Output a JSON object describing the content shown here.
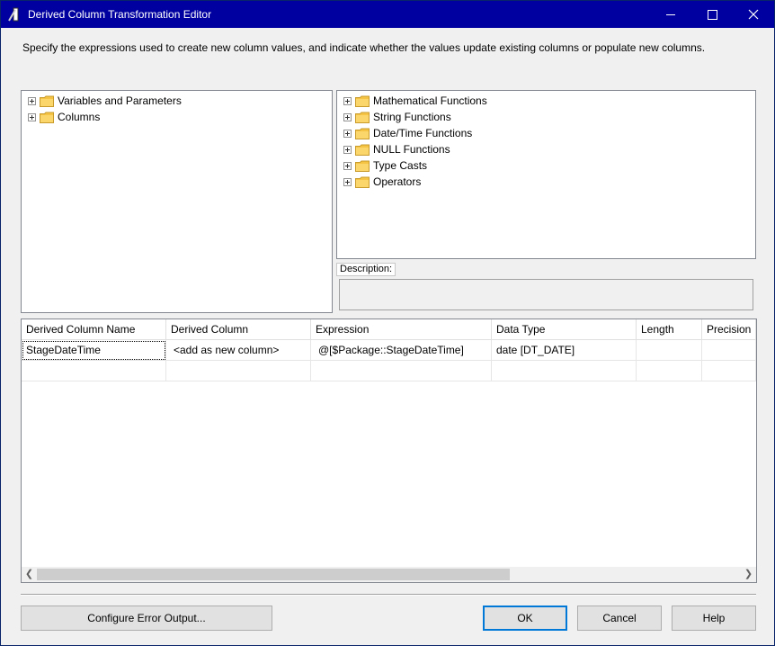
{
  "window": {
    "title": "Derived Column Transformation Editor",
    "title_bar_color": "#0000a0"
  },
  "instruction": "Specify the expressions used to create new column values, and indicate whether the values update existing columns or populate new columns.",
  "left_tree": [
    {
      "label": "Variables and Parameters",
      "icon": "folder-icon"
    },
    {
      "label": "Columns",
      "icon": "folder-icon"
    }
  ],
  "right_tree": [
    {
      "label": "Mathematical Functions",
      "icon": "folder-icon"
    },
    {
      "label": "String Functions",
      "icon": "folder-icon"
    },
    {
      "label": "Date/Time Functions",
      "icon": "folder-icon"
    },
    {
      "label": "NULL Functions",
      "icon": "folder-icon"
    },
    {
      "label": "Type Casts",
      "icon": "folder-icon"
    },
    {
      "label": "Operators",
      "icon": "folder-icon"
    }
  ],
  "description": {
    "label": "Description:",
    "text": ""
  },
  "grid": {
    "headers": [
      "Derived Column Name",
      "Derived Column",
      "Expression",
      "Data Type",
      "Length",
      "Precision"
    ],
    "rows": [
      {
        "name": "StageDateTime",
        "derived": "<add as new column>",
        "expression": "@[$Package::StageDateTime]",
        "data_type": "date [DT_DATE]",
        "length": "",
        "precision": ""
      }
    ]
  },
  "buttons": {
    "configure_error": "Configure Error Output...",
    "ok": "OK",
    "cancel": "Cancel",
    "help": "Help"
  },
  "accent_color": "#0078d7"
}
